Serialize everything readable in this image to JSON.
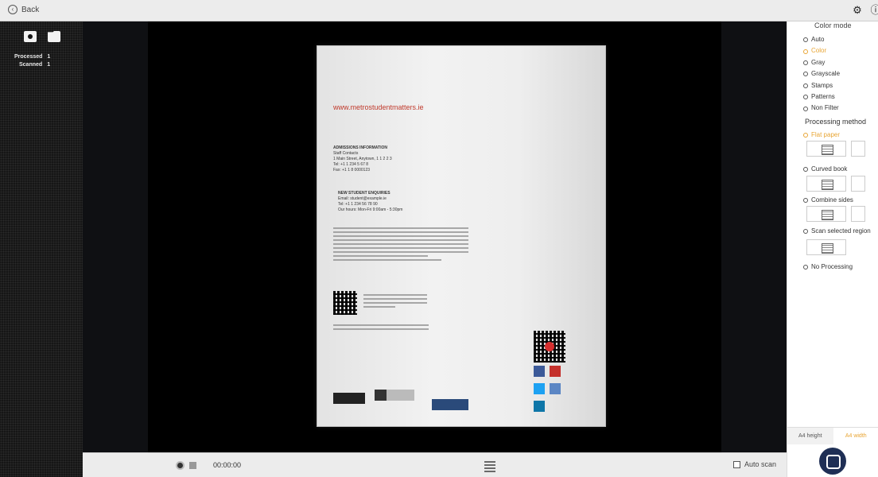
{
  "titlebar": {
    "back_label": "Back"
  },
  "left_panel": {
    "processed_label": "Processed",
    "processed_count": "1",
    "scanned_label": "Scanned",
    "scanned_count": "1"
  },
  "document": {
    "url": "www.metrostudentmatters.ie",
    "block1": [
      "ADMISSIONS INFORMATION",
      "Staff Contacts",
      "1 Main Street, Anytown, 1 1 2 2 3",
      "Tel: +1 1 234 5 67 8",
      "Fax: +1 1 8 0000123"
    ],
    "block2": [
      "NEW STUDENT ENQUIRIES",
      "Email: student@example.ie",
      "Tel: +1 1 234 56 78 90",
      "Our hours: Mon-Fri 9:00am - 5:30pm"
    ]
  },
  "bottom_bar": {
    "timer": "00:00:00",
    "autoscan_label": "Auto scan"
  },
  "right_panel": {
    "color_mode_title": "Color mode",
    "color_modes": [
      "Auto",
      "Color",
      "Gray",
      "Grayscale",
      "Stamps",
      "Patterns",
      "Non Filter"
    ],
    "processing_title": "Processing method",
    "methods": [
      "Flat paper",
      "Curved book",
      "Combine sides",
      "Scan selected region",
      "No Processing"
    ],
    "tabs": [
      "A4 height",
      "A4 width"
    ]
  },
  "colors": {
    "accent": "#e8a534",
    "scan_button": "#1f2f55"
  }
}
